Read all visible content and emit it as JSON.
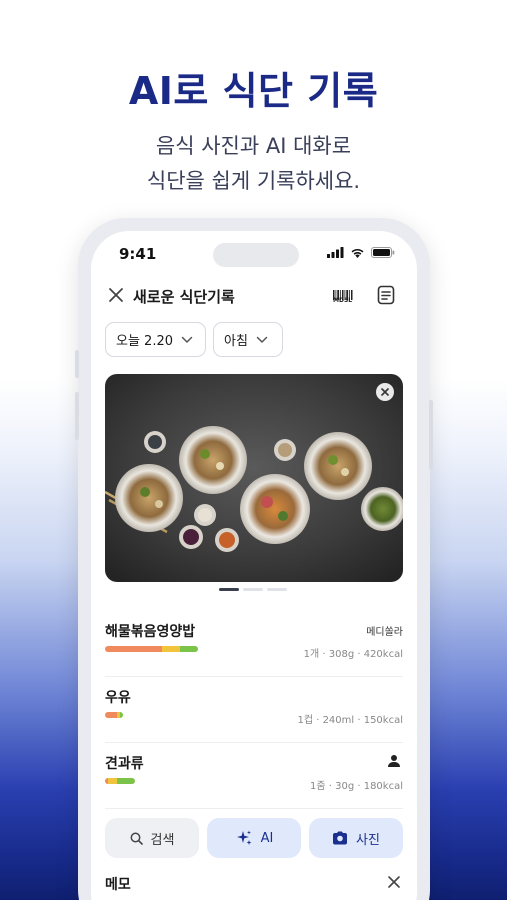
{
  "promo": {
    "headline": "AI로 식단 기록",
    "subline_1": "음식 사진과 AI 대화로",
    "subline_2": "식단을 쉽게 기록하세요."
  },
  "status_bar": {
    "time": "9:41"
  },
  "app_bar": {
    "title": "새로운 식단기록",
    "barcode_label": "MDSL"
  },
  "filters": {
    "date": "오늘 2.20",
    "meal": "아침"
  },
  "photo": {
    "pager_count": 3,
    "active_index": 0
  },
  "food_items": [
    {
      "name": "해물볶음영양밥",
      "brand": "메디쏠라",
      "info": "1개 · 308g · 420kcal",
      "bar": [
        {
          "color": "#f08a5d",
          "fraction": 0.19
        },
        {
          "color": "#f2c43b",
          "fraction": 0.06
        },
        {
          "color": "#7cc34a",
          "fraction": 0.06
        }
      ]
    },
    {
      "name": "우유",
      "brand": "",
      "info": "1컵 · 240ml · 150kcal",
      "bar": [
        {
          "color": "#f08a5d",
          "fraction": 0.04
        },
        {
          "color": "#f2c43b",
          "fraction": 0.01
        },
        {
          "color": "#7cc34a",
          "fraction": 0.01
        }
      ]
    },
    {
      "name": "견과류",
      "brand": "",
      "info": "1줌 · 30g · 180kcal",
      "bar": [
        {
          "color": "#f08a5d",
          "fraction": 0.01
        },
        {
          "color": "#f2c43b",
          "fraction": 0.03
        },
        {
          "color": "#7cc34a",
          "fraction": 0.06
        }
      ],
      "has_person_icon": true
    }
  ],
  "actions": {
    "search_label": "검색",
    "ai_label": "AI",
    "photo_label": "사진"
  },
  "memo": {
    "label": "메모"
  },
  "colors": {
    "brand_navy": "#1b2a86",
    "action_blue_bg": "#dfe9fb"
  }
}
